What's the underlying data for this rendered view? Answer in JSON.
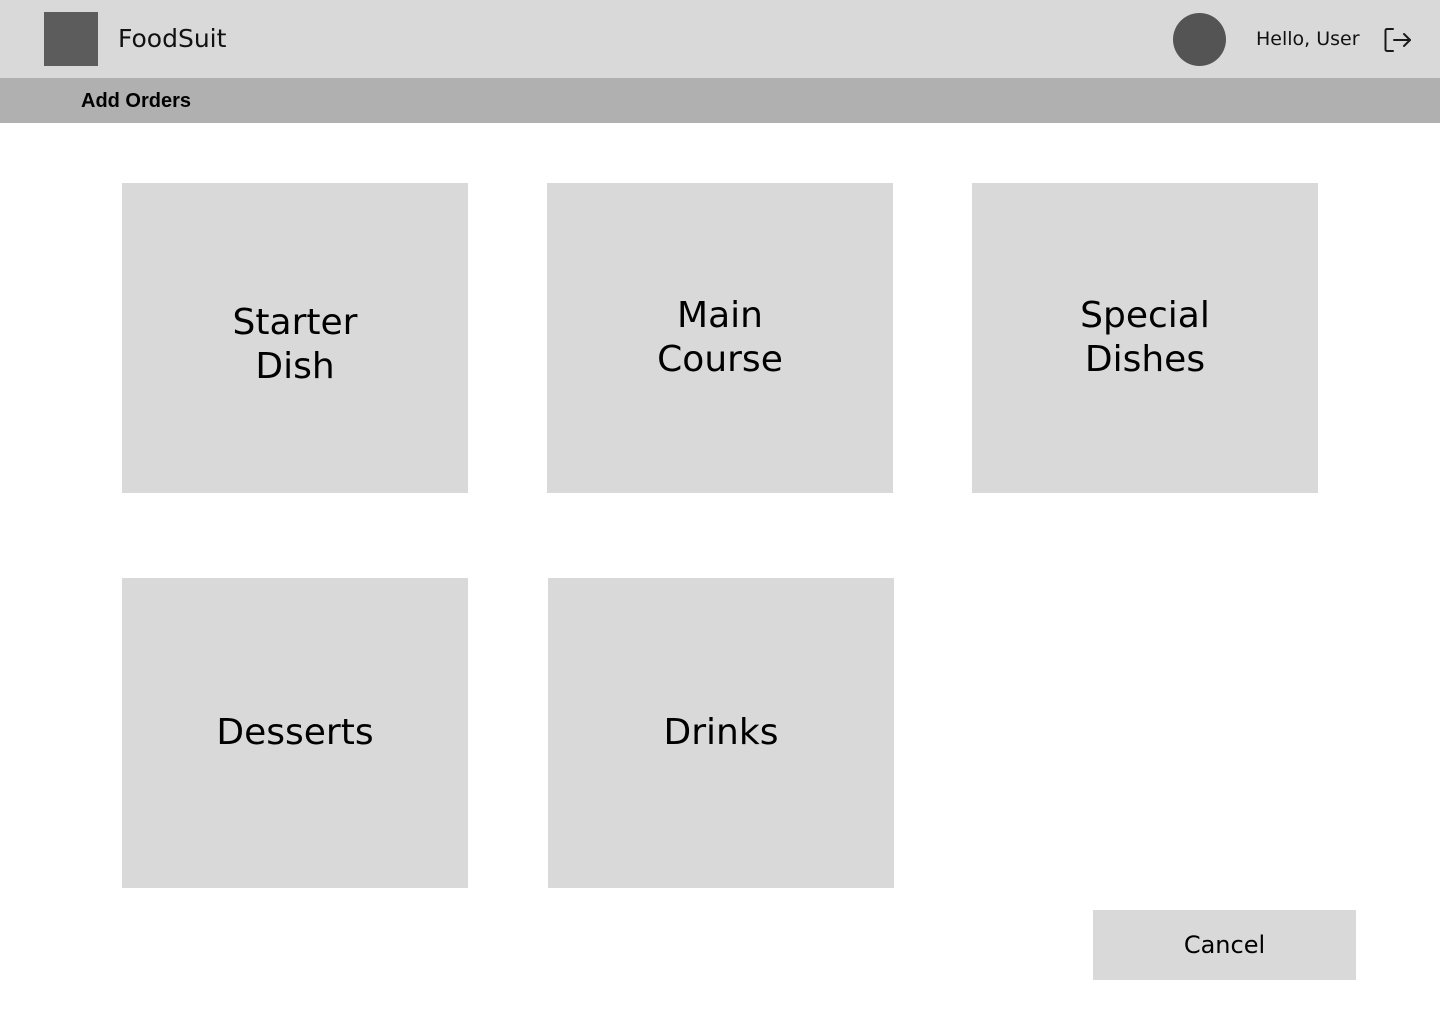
{
  "header": {
    "app_name": "FoodSuit",
    "greeting": "Hello, User",
    "logo_icon": "app-logo-placeholder",
    "avatar_icon": "user-avatar",
    "logout_icon": "logout-icon"
  },
  "subheader": {
    "title": "Add Orders"
  },
  "categories": [
    {
      "label": "Starter Dish"
    },
    {
      "label": "Main Course"
    },
    {
      "label": "Special Dishes"
    },
    {
      "label": "Desserts"
    },
    {
      "label": "Drinks"
    }
  ],
  "actions": {
    "cancel_label": "Cancel"
  },
  "colors": {
    "topbar": "#d9d9d9",
    "subbar": "#b0b0b0",
    "tile": "#d9d9d9",
    "logo": "#5c5c5c",
    "avatar": "#545454"
  }
}
